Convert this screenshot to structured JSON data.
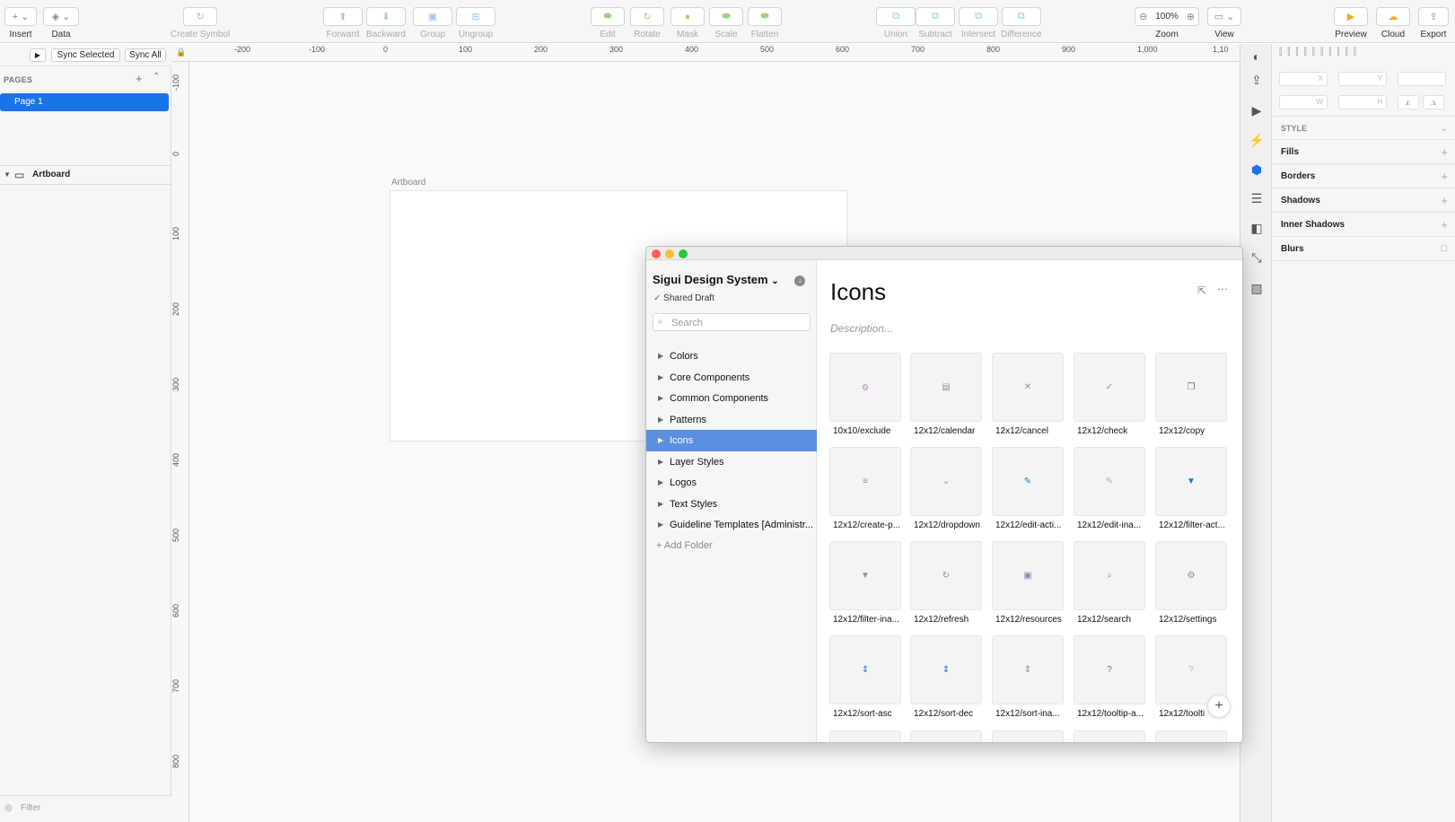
{
  "toolbar": {
    "insert": "Insert",
    "data": "Data",
    "create_symbol": "Create Symbol",
    "forward": "Forward",
    "backward": "Backward",
    "group": "Group",
    "ungroup": "Ungroup",
    "edit": "Edit",
    "rotate": "Rotate",
    "mask": "Mask",
    "scale": "Scale",
    "flatten": "Flatten",
    "union": "Union",
    "subtract": "Subtract",
    "intersect": "Intersect",
    "difference": "Difference",
    "zoom_label": "Zoom",
    "zoom_value": "100%",
    "view": "View",
    "preview": "Preview",
    "cloud": "Cloud",
    "export": "Export",
    "accent": "#f5a623"
  },
  "sync": {
    "sync_selected": "Sync Selected",
    "sync_all": "Sync All"
  },
  "pages": {
    "header": "PAGES",
    "items": [
      "Page 1"
    ],
    "selected": "Page 1"
  },
  "layers": {
    "artboard": "Artboard"
  },
  "filter": "Filter",
  "canvas": {
    "artboard_label": "Artboard"
  },
  "ruler": {
    "top": [
      "-200",
      "-100",
      "0",
      "100",
      "200",
      "300",
      "400",
      "500",
      "600",
      "700",
      "800",
      "900",
      "1,000",
      "1,10"
    ],
    "left": [
      "-100",
      "0",
      "100",
      "200",
      "300",
      "400",
      "500",
      "600",
      "700",
      "800"
    ]
  },
  "inspector": {
    "x": "X",
    "y": "Y",
    "w": "W",
    "h": "H",
    "style": "STYLE",
    "fills": "Fills",
    "borders": "Borders",
    "shadows": "Shadows",
    "inner_shadows": "Inner Shadows",
    "blurs": "Blurs"
  },
  "library": {
    "title": "Sigui Design System",
    "status": "Shared Draft",
    "search_placeholder": "Search",
    "folders": [
      "Colors",
      "Core Components",
      "Common Components",
      "Patterns",
      "Icons",
      "Layer Styles",
      "Logos",
      "Text Styles",
      "Guideline Templates [Administr..."
    ],
    "selected_folder": "Icons",
    "add_folder": "Add Folder",
    "section_title": "Icons",
    "description_placeholder": "Description...",
    "icons": [
      {
        "name": "10x10/exclude",
        "glyph": "⦸",
        "color": "#9c27b0"
      },
      {
        "name": "12x12/calendar",
        "glyph": "▤",
        "color": "#8a8fa8"
      },
      {
        "name": "12x12/cancel",
        "glyph": "✕",
        "color": "#8a8fa8"
      },
      {
        "name": "12x12/check",
        "glyph": "✓",
        "color": "#8a8fa8"
      },
      {
        "name": "12x12/copy",
        "glyph": "❐",
        "color": "#6b7080"
      },
      {
        "name": "12x12/create-p...",
        "glyph": "≡",
        "color": "#8a8fa8"
      },
      {
        "name": "12x12/dropdown",
        "glyph": "⌄",
        "color": "#8a8fa8"
      },
      {
        "name": "12x12/edit-acti...",
        "glyph": "✎",
        "color": "#1a73e8"
      },
      {
        "name": "12x12/edit-ina...",
        "glyph": "✎",
        "color": "#b0b4c2"
      },
      {
        "name": "12x12/filter-act...",
        "glyph": "▼",
        "color": "#1a73e8"
      },
      {
        "name": "12x12/filter-ina...",
        "glyph": "▼",
        "color": "#8a8fa8"
      },
      {
        "name": "12x12/refresh",
        "glyph": "↻",
        "color": "#8a8fa8"
      },
      {
        "name": "12x12/resources",
        "glyph": "▣",
        "color": "#8a8fa8"
      },
      {
        "name": "12x12/search",
        "glyph": "⌕",
        "color": "#8a8fa8"
      },
      {
        "name": "12x12/settings",
        "glyph": "⚙",
        "color": "#8a8fa8"
      },
      {
        "name": "12x12/sort-asc",
        "glyph": "⇕",
        "color": "#1a73e8"
      },
      {
        "name": "12x12/sort-dec",
        "glyph": "⇕",
        "color": "#1a73e8"
      },
      {
        "name": "12x12/sort-ina...",
        "glyph": "⇕",
        "color": "#8a8fa8"
      },
      {
        "name": "12x12/tooltip-a...",
        "glyph": "?",
        "color": "#6b7080"
      },
      {
        "name": "12x12/toolti",
        "glyph": "?",
        "color": "#b0b4c2"
      }
    ]
  }
}
